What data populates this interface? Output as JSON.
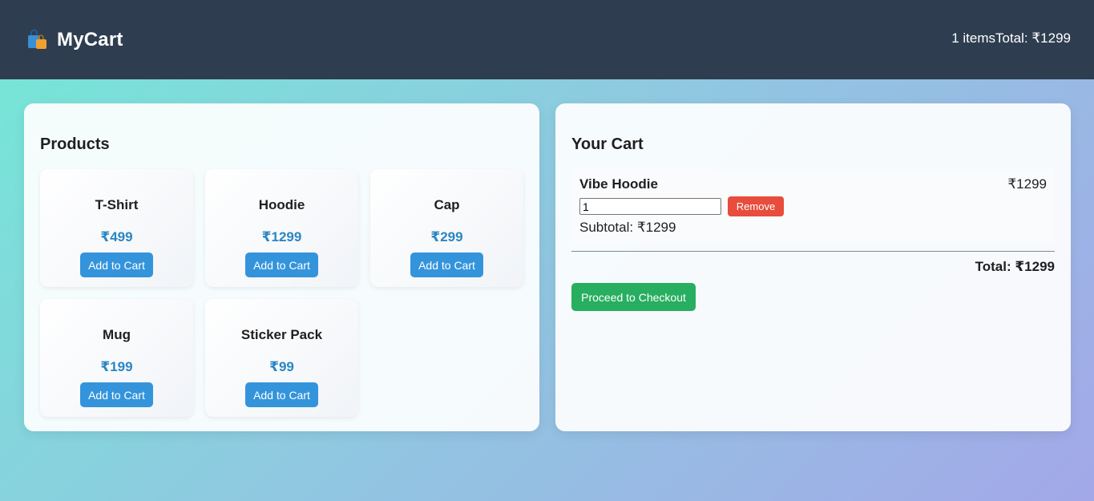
{
  "header": {
    "brand_icon": "shopping-bags-icon",
    "title": "MyCart",
    "item_count": "1 items",
    "total": "Total: ₹1299"
  },
  "products": {
    "heading": "Products",
    "items": [
      {
        "name": "T-Shirt",
        "price": "₹499",
        "button": "Add to Cart"
      },
      {
        "name": "Hoodie",
        "price": "₹1299",
        "button": "Add to Cart"
      },
      {
        "name": "Cap",
        "price": "₹299",
        "button": "Add to Cart"
      },
      {
        "name": "Mug",
        "price": "₹199",
        "button": "Add to Cart"
      },
      {
        "name": "Sticker Pack",
        "price": "₹99",
        "button": "Add to Cart"
      }
    ]
  },
  "cart": {
    "heading": "Your Cart",
    "items": [
      {
        "name": "Vibe Hoodie",
        "price": "₹1299",
        "quantity": "1",
        "remove_label": "Remove",
        "subtotal": "Subtotal: ₹1299"
      }
    ],
    "total": "Total: ₹1299",
    "checkout_label": "Proceed to Checkout"
  },
  "colors": {
    "header_bg": "#2e3e50",
    "primary_button": "#3494db",
    "price_text": "#2a86c4",
    "remove_button": "#e74c3c",
    "checkout_button": "#27ae60"
  }
}
